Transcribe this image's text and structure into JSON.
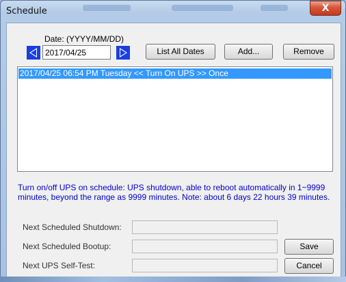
{
  "window": {
    "title": "Schedule",
    "close_glyph": "X"
  },
  "date": {
    "label": "Date:  (YYYY/MM/DD)",
    "value": "2017/04/25",
    "prev_icon": "left-arrow-icon",
    "next_icon": "right-arrow-icon"
  },
  "buttons": {
    "list_all": "List All Dates",
    "add": "Add...",
    "remove": "Remove",
    "save": "Save",
    "cancel": "Cancel"
  },
  "schedule_list": {
    "items": [
      {
        "text": "2017/04/25 06:54 PM Tuesday << Turn On UPS >> Once",
        "selected": true
      }
    ]
  },
  "info_text": "Turn on/off UPS on schedule: UPS shutdown, able to reboot automatically in 1~9999 minutes, beyond the range as 9999 minutes. Note: about 6 days 22 hours 39 minutes.",
  "fields": {
    "shutdown_label": "Next Scheduled Shutdown:",
    "shutdown_value": "",
    "bootup_label": "Next Scheduled Bootup:",
    "bootup_value": "",
    "selftest_label": "Next UPS Self-Test:",
    "selftest_value": ""
  },
  "colors": {
    "arrow_blue": "#1a3fe0",
    "selection": "#3399ff",
    "info_text": "#0000cc"
  }
}
